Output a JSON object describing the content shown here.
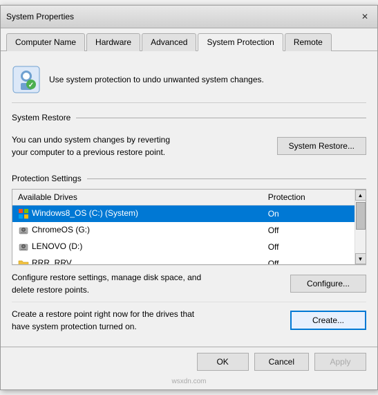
{
  "window": {
    "title": "System Properties",
    "close_label": "✕"
  },
  "tabs": [
    {
      "id": "computer-name",
      "label": "Computer Name",
      "active": false
    },
    {
      "id": "hardware",
      "label": "Hardware",
      "active": false
    },
    {
      "id": "advanced",
      "label": "Advanced",
      "active": false
    },
    {
      "id": "system-protection",
      "label": "System Protection",
      "active": true
    },
    {
      "id": "remote",
      "label": "Remote",
      "active": false
    }
  ],
  "header": {
    "text": "Use system protection to undo unwanted system changes."
  },
  "system_restore": {
    "section_label": "System Restore",
    "description": "You can undo system changes by reverting\nyour computer to a previous restore point.",
    "button_label": "System Restore..."
  },
  "protection_settings": {
    "section_label": "Protection Settings",
    "table": {
      "col_drives": "Available Drives",
      "col_protection": "Protection",
      "rows": [
        {
          "drive": "Windows8_OS (C:) (System)",
          "protection": "On",
          "selected": true,
          "icon": "system"
        },
        {
          "drive": "ChromeOS (G:)",
          "protection": "Off",
          "selected": false,
          "icon": "drive"
        },
        {
          "drive": "LENOVO (D:)",
          "protection": "Off",
          "selected": false,
          "icon": "drive"
        },
        {
          "drive": "RRR_RRV",
          "protection": "Off",
          "selected": false,
          "icon": "folder"
        }
      ]
    },
    "configure_text": "Configure restore settings, manage disk space, and\ndelete restore points.",
    "configure_button": "Configure...",
    "create_text": "Create a restore point right now for the drives that\nhave system protection turned on.",
    "create_button": "Create..."
  },
  "bottom_buttons": {
    "ok": "OK",
    "cancel": "Cancel",
    "apply": "Apply"
  },
  "watermark": "wsxdn.com"
}
